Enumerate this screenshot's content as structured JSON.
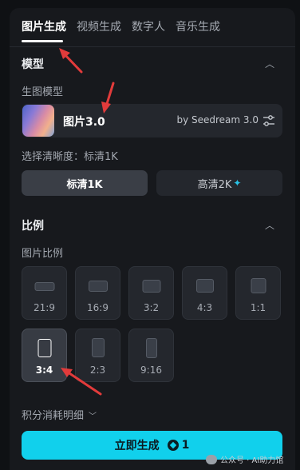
{
  "tabs": [
    {
      "label": "图片生成",
      "active": true
    },
    {
      "label": "视频生成",
      "active": false
    },
    {
      "label": "数字人",
      "active": false
    },
    {
      "label": "音乐生成",
      "active": false
    }
  ],
  "model_section": {
    "title": "模型",
    "label": "生图模型",
    "model_name": "图片3.0",
    "model_by": "by Seedream 3.0",
    "resolution_label": "选择清晰度：标清1K",
    "resolutions": [
      {
        "label": "标清1K",
        "selected": true
      },
      {
        "label": "高清2K",
        "selected": false,
        "icon": "sparkle-icon"
      }
    ]
  },
  "ratio_section": {
    "title": "比例",
    "label": "图片比例",
    "ratios": [
      {
        "label": "21:9",
        "selected": false
      },
      {
        "label": "16:9",
        "selected": false
      },
      {
        "label": "3:2",
        "selected": false
      },
      {
        "label": "4:3",
        "selected": false
      },
      {
        "label": "1:1",
        "selected": false
      },
      {
        "label": "3:4",
        "selected": true
      },
      {
        "label": "2:3",
        "selected": false
      },
      {
        "label": "9:16",
        "selected": false
      }
    ]
  },
  "cost_detail_label": "积分消耗明细",
  "generate_button": {
    "label": "立即生成",
    "credits": "1"
  },
  "watermark": {
    "text": "公众号 · AI助力馆"
  },
  "colors": {
    "accent": "#11d0ec",
    "panel": "#17191d",
    "annotation_arrow": "#e23b3b"
  }
}
